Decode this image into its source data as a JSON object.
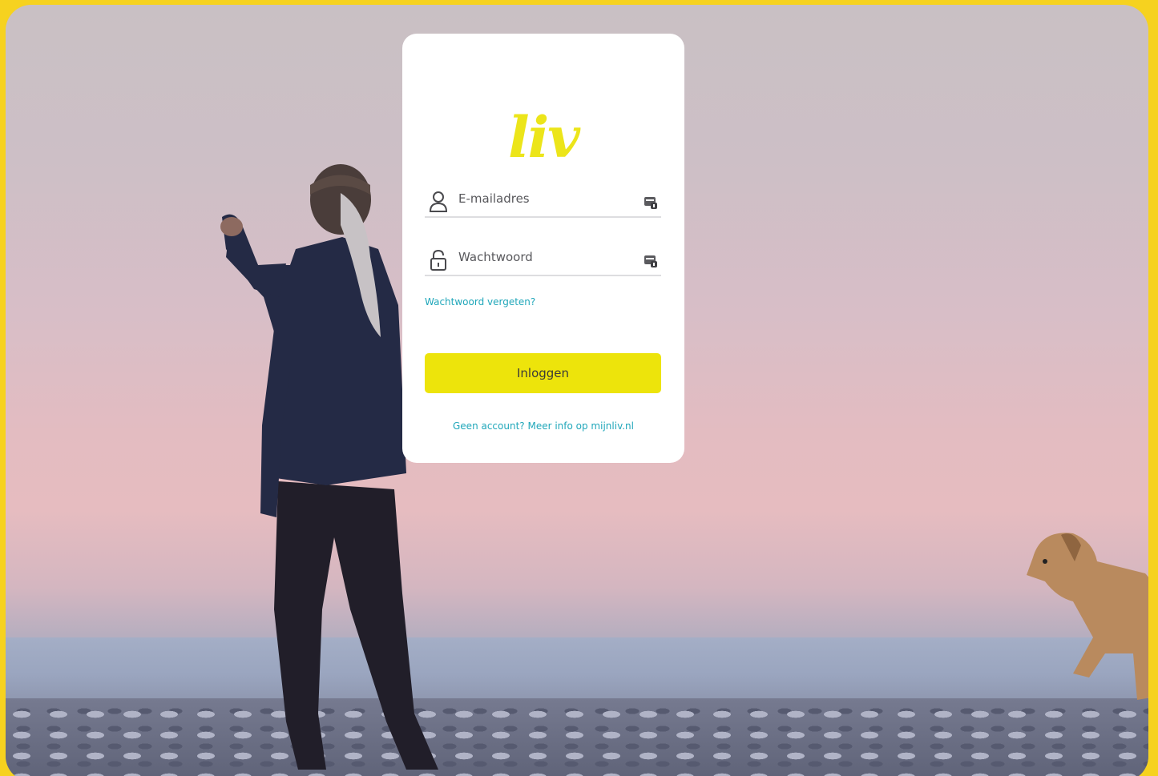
{
  "brand": {
    "logo_text": "liv",
    "accent_color": "#ede40b",
    "frame_color": "#f6d21f",
    "link_color": "#20a7ba"
  },
  "login": {
    "email": {
      "placeholder": "E-mailadres",
      "value": "",
      "icon": "user-icon",
      "trailing_icon": "password-manager-key-icon"
    },
    "password": {
      "placeholder": "Wachtwoord",
      "value": "",
      "icon": "lock-icon",
      "trailing_icon": "password-manager-key-icon"
    },
    "forgot_label": "Wachtwoord vergeten?",
    "submit_label": "Inloggen",
    "signup_label": "Geen account? Meer info op mijnliv.nl"
  },
  "background": {
    "subject": "woman-and-dog-on-pebble-beach-photo"
  }
}
